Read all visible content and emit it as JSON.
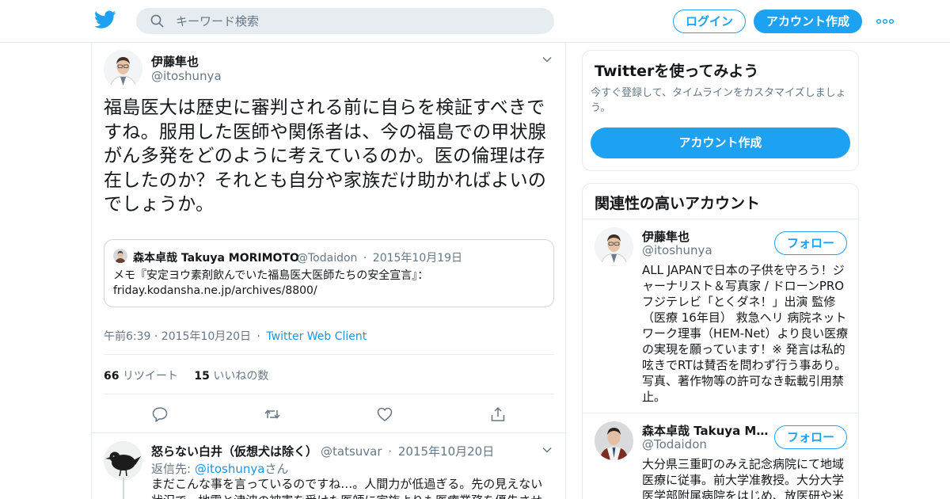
{
  "colors": {
    "accent": "#1da1f2",
    "link": "#1b95e0",
    "muted": "#657786",
    "border": "#e6ecf0"
  },
  "header": {
    "search_placeholder": "キーワード検索",
    "login_label": "ログイン",
    "signup_label": "アカウント作成"
  },
  "tweet": {
    "author_name": "伊藤隼也",
    "author_handle": "@itoshunya",
    "text": "福島医大は歴史に審判される前に自らを検証すべきですね。服用した医師や関係者は、今の福島での甲状腺がん多発をどのように考えているのか。医の倫理は存在したのか？それとも自分や家族だけ助かればよいのでしょうか。",
    "quote": {
      "name": "森本卓哉 Takuya MORIMOTO",
      "handle": "@Todaidon",
      "separator": "·",
      "date": "2015年10月19日",
      "text": "メモ『安定ヨウ素剤飲んでいた福島医大医師たちの安全宣言』：friday.kodansha.ne.jp/archives/8800/"
    },
    "timestamp": "午前6:39 · 2015年10月20日",
    "meta_separator": "·",
    "client": "Twitter Web Client",
    "retweet_count": "66",
    "retweet_label": "リツイート",
    "like_count": "15",
    "like_label": "いいねの数"
  },
  "reply": {
    "name": "怒らない白井（仮想犬は除く）",
    "handle": "@tatsuvar",
    "separator": "·",
    "date": "2015年10月20日",
    "reply_prefix": "返信先: ",
    "reply_to": "@itoshunya",
    "reply_suffix": "さん",
    "text": "まだこんな事を言っているのですね…。人間力が低過ぎる。先の見えない状況で、地震と津波の被害を受けた医師に家族よりも医療業務を優先させ"
  },
  "sidebar": {
    "signup_card": {
      "title": "Twitterを使ってみよう",
      "subtitle": "今すぐ登録して、タイムラインをカスタマイズしましょう。",
      "button_label": "アカウント作成"
    },
    "related": {
      "title": "関連性の高いアカウント",
      "accounts": [
        {
          "name": "伊藤隼也",
          "handle": "@itoshunya",
          "follow_label": "フォロー",
          "bio": "ALL JAPANで日本の子供を守ろう！ジャーナリスト＆写真家 / ドローンPRO フジテレビ「とくダネ！」出演 監修（医療 16年目） 救急ヘリ 病院ネットワーク理事（HEM-Net）より良い医療の実現を願っています！※ 発言は私的呟きでRTは賛否を問わず行う事あり。写真、著作物等の許可なき転載引用禁止。"
        },
        {
          "name": "森本卓哉 Takuya MORIMOTO",
          "handle": "@Todaidon",
          "follow_label": "フォロー",
          "bio": "大分県三重町のみえ記念病院にて地域医療に従事。前大学准教授。大分大学医学部附属病院をはじめ、放医研や米"
        }
      ]
    }
  }
}
